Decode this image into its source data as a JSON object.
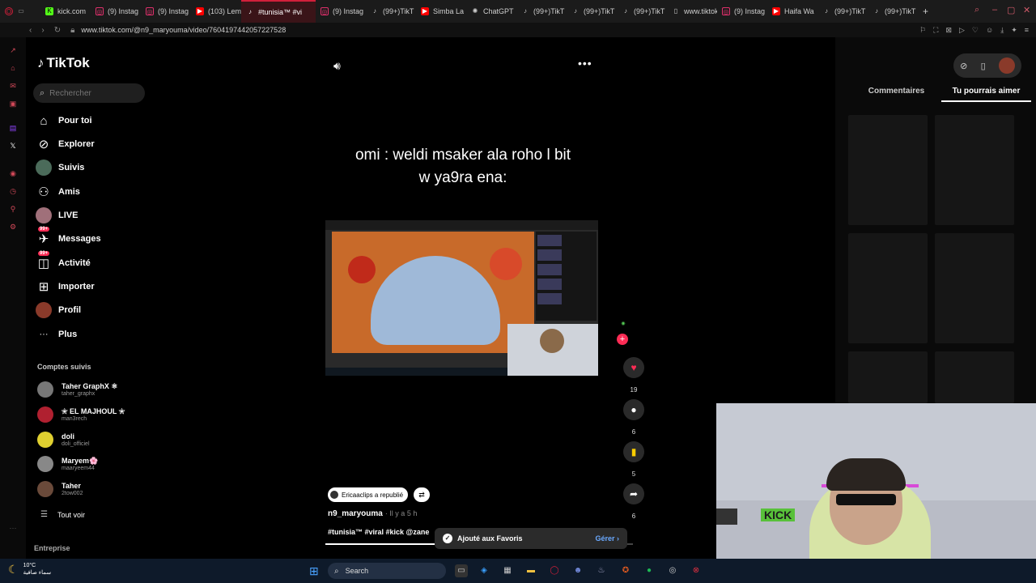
{
  "browser": {
    "tabs": [
      {
        "label": "",
        "icon": "folder-icon",
        "color": "#888888"
      },
      {
        "label": "kick.com",
        "icon": "kick-icon",
        "color": "#53fc18"
      },
      {
        "label": "(9) Instag",
        "icon": "instagram-icon",
        "color": "#e1306c"
      },
      {
        "label": "(9) Instag",
        "icon": "instagram-icon",
        "color": "#e1306c"
      },
      {
        "label": "(103) Lem",
        "icon": "youtube-icon",
        "color": "#ff0000"
      },
      {
        "label": "#tunisia™ #vi",
        "icon": "tiktok-icon",
        "color": "#ffffff",
        "active": true
      },
      {
        "label": "(9) Instag",
        "icon": "instagram-icon",
        "color": "#e1306c"
      },
      {
        "label": "(99+)TikT",
        "icon": "tiktok-icon",
        "color": "#ffffff"
      },
      {
        "label": "Simba La",
        "icon": "youtube-icon",
        "color": "#ff0000"
      },
      {
        "label": "ChatGPT",
        "icon": "chatgpt-icon",
        "color": "#ffffff"
      },
      {
        "label": "(99+)TikT",
        "icon": "tiktok-icon",
        "color": "#ffffff"
      },
      {
        "label": "(99+)TikT",
        "icon": "tiktok-icon",
        "color": "#ffffff"
      },
      {
        "label": "(99+)TikT",
        "icon": "tiktok-icon",
        "color": "#ffffff"
      },
      {
        "label": "www.tiktok",
        "icon": "page-icon",
        "color": "#cccccc"
      },
      {
        "label": "(9) Instag",
        "icon": "instagram-icon",
        "color": "#e1306c"
      },
      {
        "label": "Haifa Wa",
        "icon": "youtube-icon",
        "color": "#ff0000"
      },
      {
        "label": "(99+)TikT",
        "icon": "tiktok-icon",
        "color": "#ffffff"
      },
      {
        "label": "(99+)TikT",
        "icon": "tiktok-icon",
        "color": "#ffffff"
      }
    ],
    "new_tab": "+",
    "url": "www.tiktok.com/@n9_maryouma/video/7604197442057227528"
  },
  "sidebar": {
    "logo": "TikTok",
    "search_placeholder": "Rechercher",
    "nav": [
      {
        "label": "Pour toi",
        "icon": "home-icon"
      },
      {
        "label": "Explorer",
        "icon": "compass-icon"
      },
      {
        "label": "Suivis",
        "icon": "following-avatar-icon"
      },
      {
        "label": "Amis",
        "icon": "friends-icon"
      },
      {
        "label": "LIVE",
        "icon": "live-avatar-icon"
      },
      {
        "label": "Messages",
        "icon": "messages-icon",
        "badge": "99+"
      },
      {
        "label": "Activité",
        "icon": "activity-icon",
        "badge": "99+"
      },
      {
        "label": "Importer",
        "icon": "upload-icon"
      },
      {
        "label": "Profil",
        "icon": "profile-avatar-icon"
      },
      {
        "label": "Plus",
        "icon": "more-icon"
      }
    ],
    "following_heading": "Comptes suivis",
    "accounts": [
      {
        "name": "Taher GraphX ⚛",
        "handle": "taher_graphx"
      },
      {
        "name": "✬ EL MAJHOUL ✬",
        "handle": "man3rech"
      },
      {
        "name": "doli",
        "handle": "doli_officiel"
      },
      {
        "name": "Maryem🌸",
        "handle": "maaryeem44"
      },
      {
        "name": "Taher",
        "handle": "2tow002"
      }
    ],
    "see_all": "Tout voir",
    "company": "Entreprise"
  },
  "video": {
    "caption": "omi : weldi  msaker  ala roho l bit w ya9ra ena:",
    "likes": "19",
    "comments": "6",
    "saves": "5",
    "shares": "6",
    "reposted_by": "Ericaaclips a republié",
    "author": "n9_maryouma",
    "posted": "· Il y a 5 h",
    "tags": "#tunisia™ #viral #kick @zane",
    "progress": 0.97
  },
  "toast": {
    "message": "Ajouté aux Favoris",
    "action": "Gérer"
  },
  "right_panel": {
    "tabs": [
      "Commentaires",
      "Tu pourrais aimer"
    ],
    "active_tab": 1
  },
  "webcam": {
    "sign": "KICK"
  },
  "taskbar": {
    "temp": "10°C",
    "weather": "سماء صافية",
    "search": "Search"
  }
}
